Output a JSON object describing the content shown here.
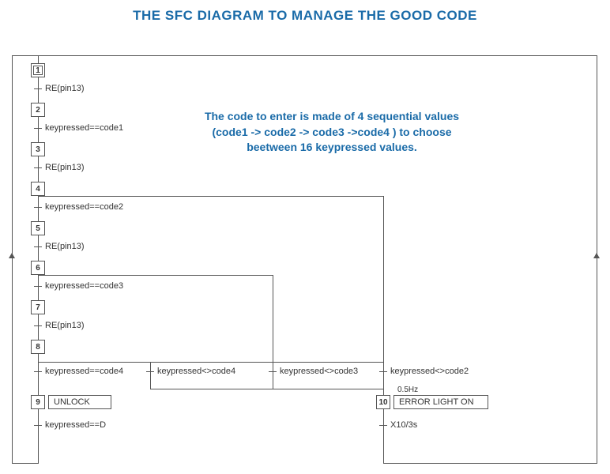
{
  "title": "THE SFC DIAGRAM TO MANAGE THE GOOD CODE",
  "description": "The code to enter is made of 4 sequential values (code1 -> code2 -> code3 ->code4 ) to choose beetween 16 keypressed values.",
  "steps": {
    "s1": "1",
    "s2": "2",
    "s3": "3",
    "s4": "4",
    "s5": "5",
    "s6": "6",
    "s7": "7",
    "s8": "8",
    "s9": "9",
    "s10": "10"
  },
  "actions": {
    "unlock": "UNLOCK",
    "error": "ERROR LIGHT ON"
  },
  "transitions": {
    "t1": "RE(pin13)",
    "t2": "keypressed==code1",
    "t3": "RE(pin13)",
    "t4": "keypressed==code2",
    "t5": "RE(pin13)",
    "t6": "keypressed==code3",
    "t7": "RE(pin13)",
    "t8a": "keypressed==code4",
    "t8b": "keypressed<>code4",
    "t8c": "keypressed<>code3",
    "t8d": "keypressed<>code2",
    "t9": "keypressed==D",
    "t10": "X10/3s"
  },
  "qualifier": "0.5Hz"
}
